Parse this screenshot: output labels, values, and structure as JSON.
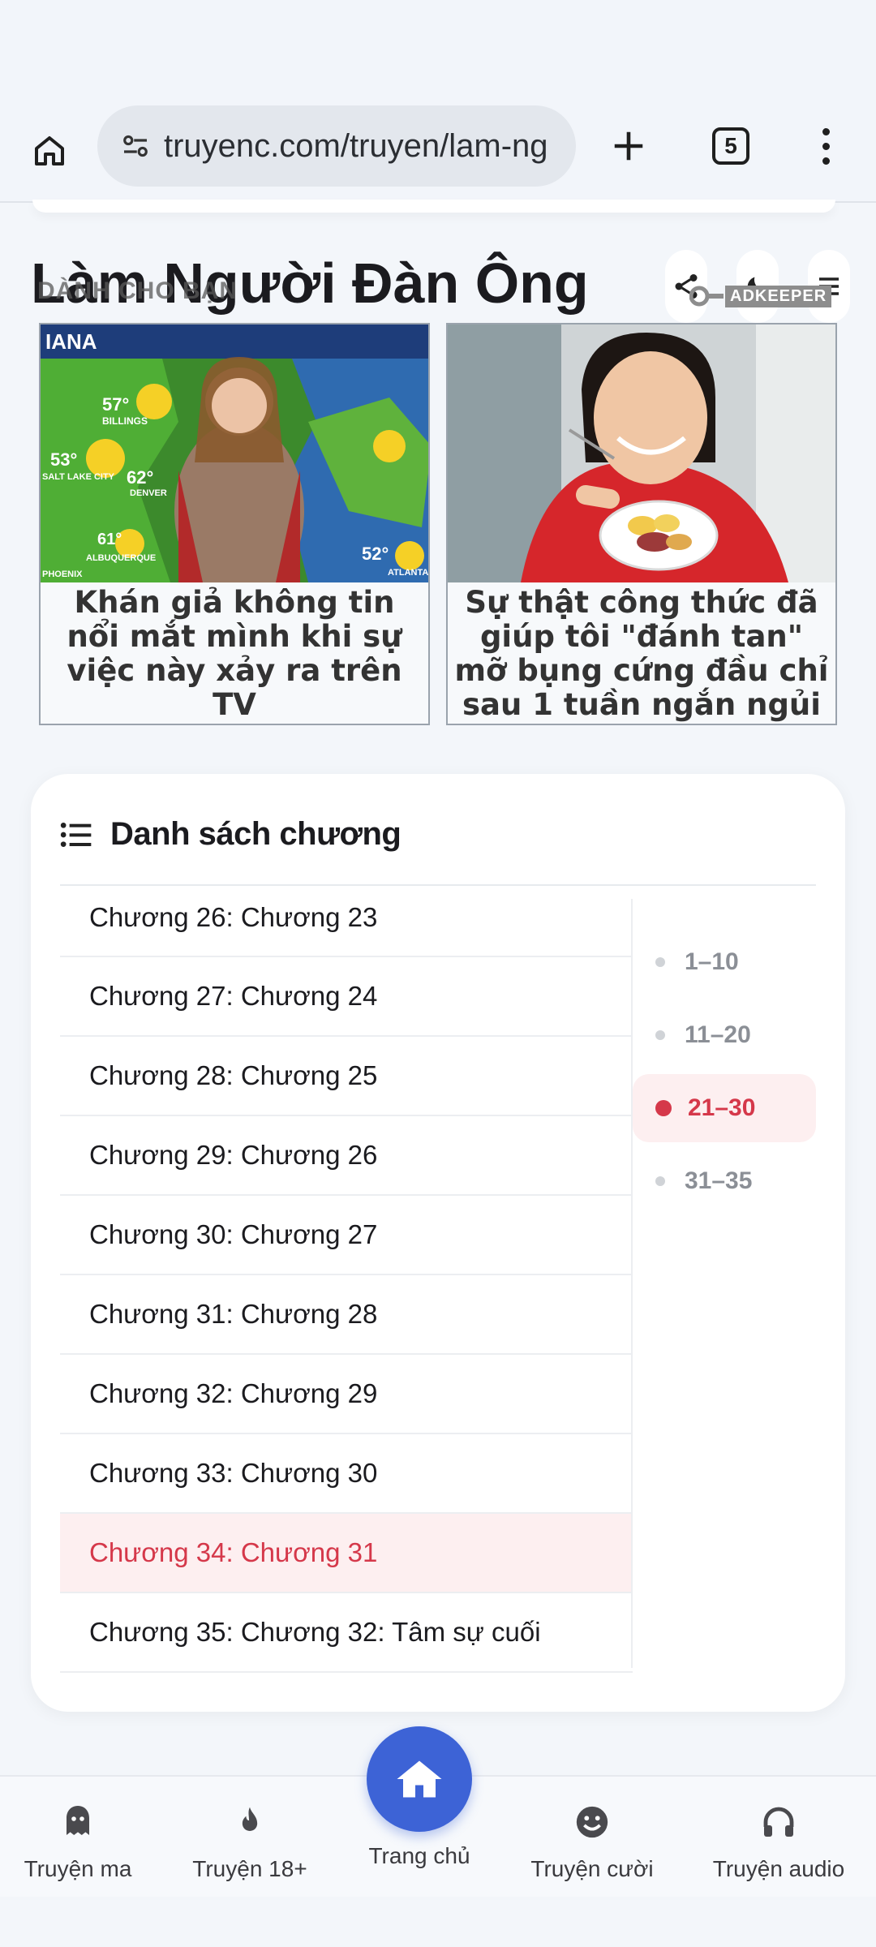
{
  "browser": {
    "url": "truyenc.com/truyen/lam-ng",
    "tab_count": "5",
    "icons": [
      "home-icon",
      "tune-icon",
      "plus-icon",
      "tabs-icon",
      "more-vert-icon"
    ]
  },
  "story": {
    "title": "Làm Người Đàn Ông",
    "tools": [
      "share-icon",
      "moon-icon",
      "menu-icon"
    ]
  },
  "ad": {
    "label": "DÀNH CHO BẠN",
    "brand": "ADKEEPER",
    "items": [
      {
        "caption": "Khán giả không tin nổi mắt mình khi sự việc này xảy ra trên TV",
        "map_labels": [
          "IANA",
          "57°",
          "BILLINGS",
          "53°",
          "SALT LAKE CITY",
          "62°",
          "DENVER",
          "61°",
          "ALBUQUERQUE",
          "PHOENIX",
          "52°",
          "ATLANTA"
        ]
      },
      {
        "caption": "Sự thật công thức đã giúp tôi \"đánh tan\" mỡ bụng cứng đầu chỉ sau 1 tuần ngắn ngủi"
      }
    ]
  },
  "chapters": {
    "heading": "Danh sách chương",
    "items": [
      "Chương 26: Chương 23",
      "Chương 27: Chương 24",
      "Chương 28: Chương 25",
      "Chương 29: Chương 26",
      "Chương 30: Chương 27",
      "Chương 31: Chương 28",
      "Chương 32: Chương 29",
      "Chương 33: Chương 30",
      "Chương 34: Chương 31",
      "Chương 35: Chương 32: Tâm sự cuối"
    ],
    "active_item": "Chương 34: Chương 31",
    "ranges": [
      "1–10",
      "11–20",
      "21–30",
      "31–35"
    ],
    "active_range": "21–30"
  },
  "bottom_nav": {
    "items": [
      "Truyện ma",
      "Truyện 18+",
      "Trang chủ",
      "Truyện cười",
      "Truyện audio"
    ]
  },
  "colors": {
    "accent_red": "#d5384a",
    "fab_blue": "#3d63d6",
    "active_bg": "#fdeff0"
  }
}
